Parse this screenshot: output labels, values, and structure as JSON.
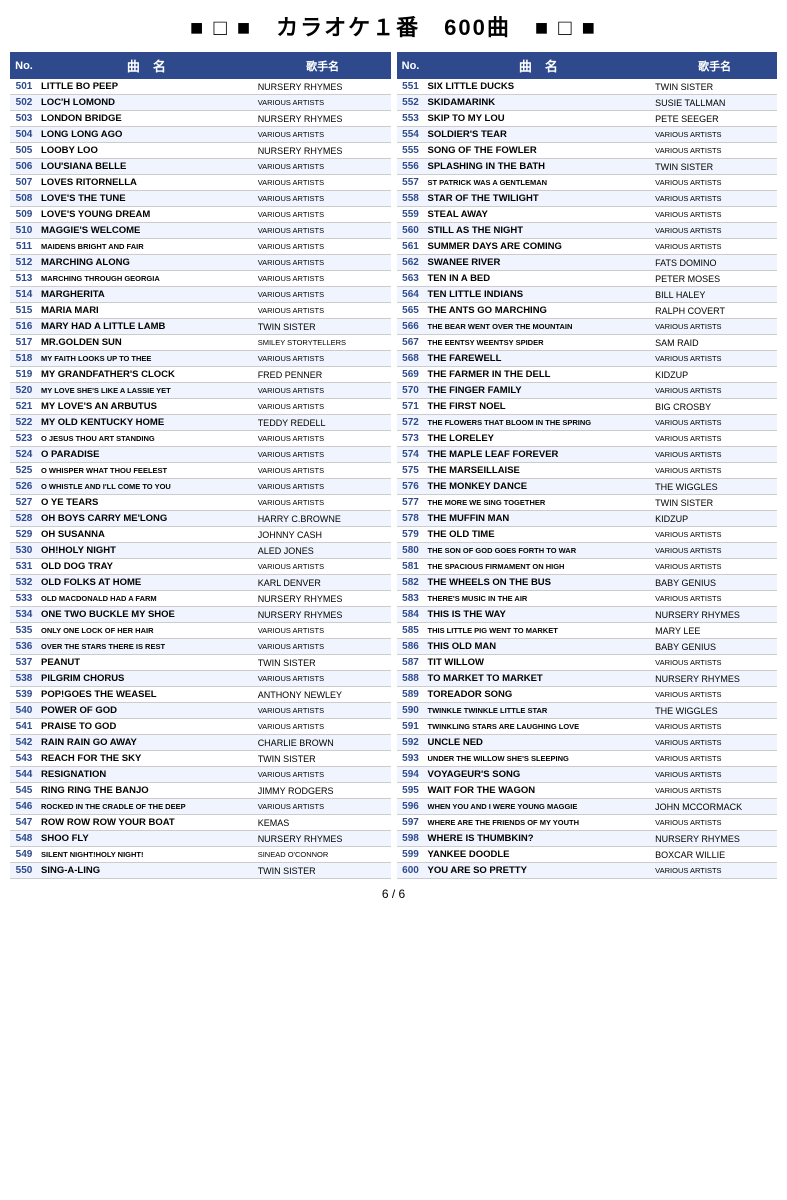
{
  "header": {
    "title": "■ □ ■　カラオケ１番　600曲　■ □ ■"
  },
  "footer": {
    "page": "6 / 6"
  },
  "left_table": {
    "headers": [
      "No.",
      "曲　名",
      "歌手名"
    ],
    "rows": [
      [
        "501",
        "LITTLE BO PEEP",
        "NURSERY RHYMES"
      ],
      [
        "502",
        "LOC'H LOMOND",
        "VARIOUS ARTISTS"
      ],
      [
        "503",
        "LONDON BRIDGE",
        "NURSERY RHYMES"
      ],
      [
        "504",
        "LONG LONG AGO",
        "VARIOUS ARTISTS"
      ],
      [
        "505",
        "LOOBY LOO",
        "NURSERY RHYMES"
      ],
      [
        "506",
        "LOU'SIANA BELLE",
        "VARIOUS ARTISTS"
      ],
      [
        "507",
        "LOVES RITORNELLA",
        "VARIOUS ARTISTS"
      ],
      [
        "508",
        "LOVE'S THE TUNE",
        "VARIOUS ARTISTS"
      ],
      [
        "509",
        "LOVE'S YOUNG DREAM",
        "VARIOUS ARTISTS"
      ],
      [
        "510",
        "MAGGIE'S WELCOME",
        "VARIOUS ARTISTS"
      ],
      [
        "511",
        "MAIDENS BRIGHT AND FAIR",
        "VARIOUS ARTISTS"
      ],
      [
        "512",
        "MARCHING ALONG",
        "VARIOUS ARTISTS"
      ],
      [
        "513",
        "MARCHING THROUGH GEORGIA",
        "VARIOUS ARTISTS"
      ],
      [
        "514",
        "MARGHERITA",
        "VARIOUS ARTISTS"
      ],
      [
        "515",
        "MARIA MARI",
        "VARIOUS ARTISTS"
      ],
      [
        "516",
        "MARY HAD A LITTLE LAMB",
        "TWIN SISTER"
      ],
      [
        "517",
        "MR.GOLDEN SUN",
        "SMILEY STORYTELLERS"
      ],
      [
        "518",
        "MY FAITH LOOKS UP TO THEE",
        "VARIOUS ARTISTS"
      ],
      [
        "519",
        "MY GRANDFATHER'S CLOCK",
        "FRED PENNER"
      ],
      [
        "520",
        "MY LOVE SHE'S LIKE A LASSIE YET",
        "VARIOUS ARTISTS"
      ],
      [
        "521",
        "MY LOVE'S AN ARBUTUS",
        "VARIOUS ARTISTS"
      ],
      [
        "522",
        "MY OLD KENTUCKY HOME",
        "TEDDY REDELL"
      ],
      [
        "523",
        "O JESUS THOU ART STANDING",
        "VARIOUS ARTISTS"
      ],
      [
        "524",
        "O PARADISE",
        "VARIOUS ARTISTS"
      ],
      [
        "525",
        "O WHISPER WHAT THOU FEELEST",
        "VARIOUS ARTISTS"
      ],
      [
        "526",
        "O WHISTLE AND I'LL COME TO YOU",
        "VARIOUS ARTISTS"
      ],
      [
        "527",
        "O YE TEARS",
        "VARIOUS ARTISTS"
      ],
      [
        "528",
        "OH BOYS CARRY ME'LONG",
        "HARRY C.BROWNE"
      ],
      [
        "529",
        "OH SUSANNA",
        "JOHNNY CASH"
      ],
      [
        "530",
        "OH!HOLY NIGHT",
        "ALED JONES"
      ],
      [
        "531",
        "OLD DOG TRAY",
        "VARIOUS ARTISTS"
      ],
      [
        "532",
        "OLD FOLKS AT HOME",
        "KARL DENVER"
      ],
      [
        "533",
        "OLD MACDONALD HAD A FARM",
        "NURSERY RHYMES"
      ],
      [
        "534",
        "ONE TWO BUCKLE MY SHOE",
        "NURSERY RHYMES"
      ],
      [
        "535",
        "ONLY ONE LOCK OF HER HAIR",
        "VARIOUS ARTISTS"
      ],
      [
        "536",
        "OVER THE STARS THERE IS REST",
        "VARIOUS ARTISTS"
      ],
      [
        "537",
        "PEANUT",
        "TWIN SISTER"
      ],
      [
        "538",
        "PILGRIM CHORUS",
        "VARIOUS ARTISTS"
      ],
      [
        "539",
        "POP!GOES THE WEASEL",
        "ANTHONY NEWLEY"
      ],
      [
        "540",
        "POWER OF GOD",
        "VARIOUS ARTISTS"
      ],
      [
        "541",
        "PRAISE TO GOD",
        "VARIOUS ARTISTS"
      ],
      [
        "542",
        "RAIN RAIN GO AWAY",
        "CHARLIE BROWN"
      ],
      [
        "543",
        "REACH FOR THE SKY",
        "TWIN SISTER"
      ],
      [
        "544",
        "RESIGNATION",
        "VARIOUS ARTISTS"
      ],
      [
        "545",
        "RING RING THE BANJO",
        "JIMMY RODGERS"
      ],
      [
        "546",
        "ROCKED IN THE CRADLE OF THE DEEP",
        "VARIOUS ARTISTS"
      ],
      [
        "547",
        "ROW ROW ROW YOUR BOAT",
        "KEMAS"
      ],
      [
        "548",
        "SHOO FLY",
        "NURSERY RHYMES"
      ],
      [
        "549",
        "SILENT NIGHT!HOLY NIGHT!",
        "SINEAD O'CONNOR"
      ],
      [
        "550",
        "SING-A-LING",
        "TWIN SISTER"
      ]
    ]
  },
  "right_table": {
    "headers": [
      "No.",
      "曲　名",
      "歌手名"
    ],
    "rows": [
      [
        "551",
        "SIX LITTLE DUCKS",
        "TWIN SISTER"
      ],
      [
        "552",
        "SKIDAMARINK",
        "SUSIE TALLMAN"
      ],
      [
        "553",
        "SKIP TO MY LOU",
        "PETE SEEGER"
      ],
      [
        "554",
        "SOLDIER'S TEAR",
        "VARIOUS ARTISTS"
      ],
      [
        "555",
        "SONG OF THE FOWLER",
        "VARIOUS ARTISTS"
      ],
      [
        "556",
        "SPLASHING IN THE BATH",
        "TWIN SISTER"
      ],
      [
        "557",
        "ST PATRICK WAS A GENTLEMAN",
        "VARIOUS ARTISTS"
      ],
      [
        "558",
        "STAR OF THE TWILIGHT",
        "VARIOUS ARTISTS"
      ],
      [
        "559",
        "STEAL AWAY",
        "VARIOUS ARTISTS"
      ],
      [
        "560",
        "STILL AS THE NIGHT",
        "VARIOUS ARTISTS"
      ],
      [
        "561",
        "SUMMER DAYS ARE COMING",
        "VARIOUS ARTISTS"
      ],
      [
        "562",
        "SWANEE RIVER",
        "FATS DOMINO"
      ],
      [
        "563",
        "TEN IN A BED",
        "PETER MOSES"
      ],
      [
        "564",
        "TEN LITTLE INDIANS",
        "BILL HALEY"
      ],
      [
        "565",
        "THE ANTS GO MARCHING",
        "RALPH COVERT"
      ],
      [
        "566",
        "THE BEAR WENT OVER THE MOUNTAIN",
        "VARIOUS ARTISTS"
      ],
      [
        "567",
        "THE EENTSY WEENTSY SPIDER",
        "SAM RAID"
      ],
      [
        "568",
        "THE FAREWELL",
        "VARIOUS ARTISTS"
      ],
      [
        "569",
        "THE FARMER IN THE DELL",
        "KIDZUP"
      ],
      [
        "570",
        "THE FINGER FAMILY",
        "VARIOUS ARTISTS"
      ],
      [
        "571",
        "THE FIRST NOEL",
        "BIG CROSBY"
      ],
      [
        "572",
        "THE FLOWERS THAT BLOOM IN THE SPRING",
        "VARIOUS ARTISTS"
      ],
      [
        "573",
        "THE LORELEY",
        "VARIOUS ARTISTS"
      ],
      [
        "574",
        "THE MAPLE LEAF FOREVER",
        "VARIOUS ARTISTS"
      ],
      [
        "575",
        "THE MARSEILLAISE",
        "VARIOUS ARTISTS"
      ],
      [
        "576",
        "THE MONKEY DANCE",
        "THE WIGGLES"
      ],
      [
        "577",
        "THE MORE WE SING TOGETHER",
        "TWIN SISTER"
      ],
      [
        "578",
        "THE MUFFIN MAN",
        "KIDZUP"
      ],
      [
        "579",
        "THE OLD TIME",
        "VARIOUS ARTISTS"
      ],
      [
        "580",
        "THE SON OF GOD GOES FORTH TO WAR",
        "VARIOUS ARTISTS"
      ],
      [
        "581",
        "THE SPACIOUS FIRMAMENT ON HIGH",
        "VARIOUS ARTISTS"
      ],
      [
        "582",
        "THE WHEELS ON THE BUS",
        "BABY GENIUS"
      ],
      [
        "583",
        "THERE'S MUSIC IN THE AIR",
        "VARIOUS ARTISTS"
      ],
      [
        "584",
        "THIS IS THE WAY",
        "NURSERY RHYMES"
      ],
      [
        "585",
        "THIS LITTLE PIG WENT TO MARKET",
        "MARY LEE"
      ],
      [
        "586",
        "THIS OLD MAN",
        "BABY GENIUS"
      ],
      [
        "587",
        "TIT WILLOW",
        "VARIOUS ARTISTS"
      ],
      [
        "588",
        "TO MARKET TO MARKET",
        "NURSERY RHYMES"
      ],
      [
        "589",
        "TOREADOR SONG",
        "VARIOUS ARTISTS"
      ],
      [
        "590",
        "TWINKLE TWINKLE LITTLE  STAR",
        "THE  WIGGLES"
      ],
      [
        "591",
        "TWINKLING STARS ARE LAUGHING LOVE",
        "VARIOUS ARTISTS"
      ],
      [
        "592",
        "UNCLE NED",
        "VARIOUS ARTISTS"
      ],
      [
        "593",
        "UNDER THE WILLOW SHE'S SLEEPING",
        "VARIOUS ARTISTS"
      ],
      [
        "594",
        "VOYAGEUR'S SONG",
        "VARIOUS ARTISTS"
      ],
      [
        "595",
        "WAIT FOR THE WAGON",
        "VARIOUS ARTISTS"
      ],
      [
        "596",
        "WHEN YOU AND I WERE YOUNG MAGGIE",
        "JOHN MCCORMACK"
      ],
      [
        "597",
        "WHERE ARE THE FRIENDS OF MY YOUTH",
        "VARIOUS ARTISTS"
      ],
      [
        "598",
        "WHERE IS THUMBKIN?",
        "NURSERY RHYMES"
      ],
      [
        "599",
        "YANKEE DOODLE",
        "BOXCAR WILLIE"
      ],
      [
        "600",
        "YOU ARE SO PRETTY",
        "VARIOUS ARTISTS"
      ]
    ]
  }
}
